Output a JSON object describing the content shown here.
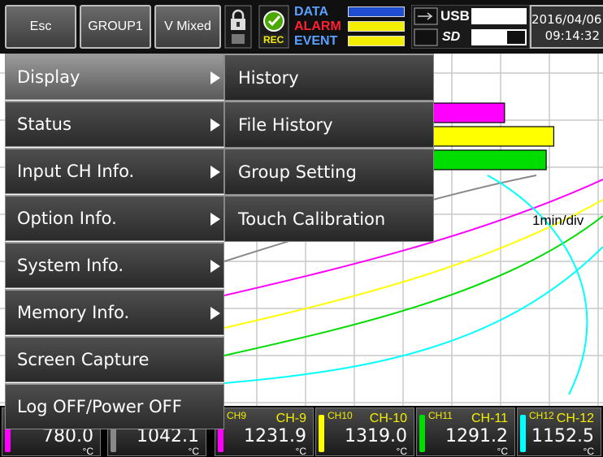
{
  "topbar": {
    "esc_label": "Esc",
    "group_label": "GROUP1",
    "mode_label": "V Mixed",
    "rec_label": "REC",
    "status": {
      "data_label": "DATA",
      "alarm_label": "ALARM",
      "event_label": "EVENT",
      "data_color": "#1f4fd0",
      "alarm_color": "#e01020",
      "event_color": "#1f4fd0"
    },
    "usb_label": "USB",
    "sd_label": "SD",
    "date": "2016/04/06",
    "time": "09:14:32"
  },
  "chart": {
    "scale_label": "1min/div",
    "bars": [
      {
        "color": "#888888",
        "level": 0.54
      },
      {
        "color": "#ff00ff",
        "level": 0.74
      },
      {
        "color": "#ffff00",
        "level": 0.87
      },
      {
        "color": "#00dd00",
        "level": 0.85
      },
      {
        "color": "#00ffff",
        "level": 0.46
      }
    ],
    "trend_colors": [
      "#888888",
      "#ff00ff",
      "#ffff00",
      "#00dd00",
      "#00ffff"
    ]
  },
  "menu": {
    "items": [
      {
        "label": "Display",
        "has_sub": true,
        "active": true
      },
      {
        "label": "Status",
        "has_sub": true
      },
      {
        "label": "Input CH Info.",
        "has_sub": true
      },
      {
        "label": "Option Info.",
        "has_sub": true
      },
      {
        "label": "System Info.",
        "has_sub": true
      },
      {
        "label": "Memory Info.",
        "has_sub": true
      },
      {
        "label": "Screen Capture",
        "has_sub": false
      },
      {
        "label": "Log OFF/Power OFF",
        "has_sub": false
      }
    ],
    "submenu": [
      {
        "label": "History"
      },
      {
        "label": "File History"
      },
      {
        "label": "Group Setting"
      },
      {
        "label": "Touch Calibration"
      }
    ]
  },
  "channels": [
    {
      "tag": "",
      "name": "",
      "value": "780.0",
      "unit": "°C",
      "color": "#ff00ff"
    },
    {
      "tag": "",
      "name": "",
      "value": "1042.1",
      "unit": "°C",
      "color": "#888888"
    },
    {
      "tag": "CH9",
      "name": "CH-9",
      "value": "1231.9",
      "unit": "°C",
      "color": "#ff00ff"
    },
    {
      "tag": "CH10",
      "name": "CH-10",
      "value": "1319.0",
      "unit": "°C",
      "color": "#ffff00"
    },
    {
      "tag": "CH11",
      "name": "CH-11",
      "value": "1291.2",
      "unit": "°C",
      "color": "#00dd00"
    },
    {
      "tag": "CH12",
      "name": "CH-12",
      "value": "1152.5",
      "unit": "°C",
      "color": "#00ffff"
    }
  ]
}
